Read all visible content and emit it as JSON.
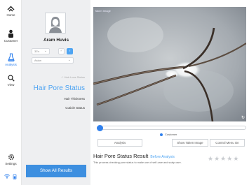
{
  "nav": {
    "items": [
      {
        "key": "home",
        "label": "Home",
        "icon": "home-icon"
      },
      {
        "key": "customer",
        "label": "Customer",
        "icon": "person-icon"
      },
      {
        "key": "analysis",
        "label": "Analysis",
        "icon": "flask-icon",
        "active": true
      },
      {
        "key": "view",
        "label": "View",
        "icon": "magnifier-icon"
      }
    ],
    "settings_label": "Settings"
  },
  "profile": {
    "name": "Aram Huvis",
    "age": "33's",
    "skin_select": "Asian"
  },
  "menu": {
    "hair_loss": "Hair Loss Status",
    "hair_pore": "Hair Pore Status",
    "hair_thickness": "Hair Thickness",
    "cuticle": "Cuticle Status"
  },
  "show_all_button": "Show All Results",
  "image": {
    "label": "Taken Image"
  },
  "controls": {
    "customer_label": "Customer",
    "analysis_button": "Analysis",
    "show_taken_button": "Show Taken Image",
    "control_menu_button": "Control Menu On"
  },
  "result": {
    "title": "Hair Pore Status Result",
    "subtitle": "Before Analysis",
    "description": "This process checking pore status to make use of self-care and scalp care.",
    "rating": 0,
    "rating_max": 5
  },
  "colors": {
    "accent": "#4ea4f2",
    "button": "#3d8fe0"
  }
}
